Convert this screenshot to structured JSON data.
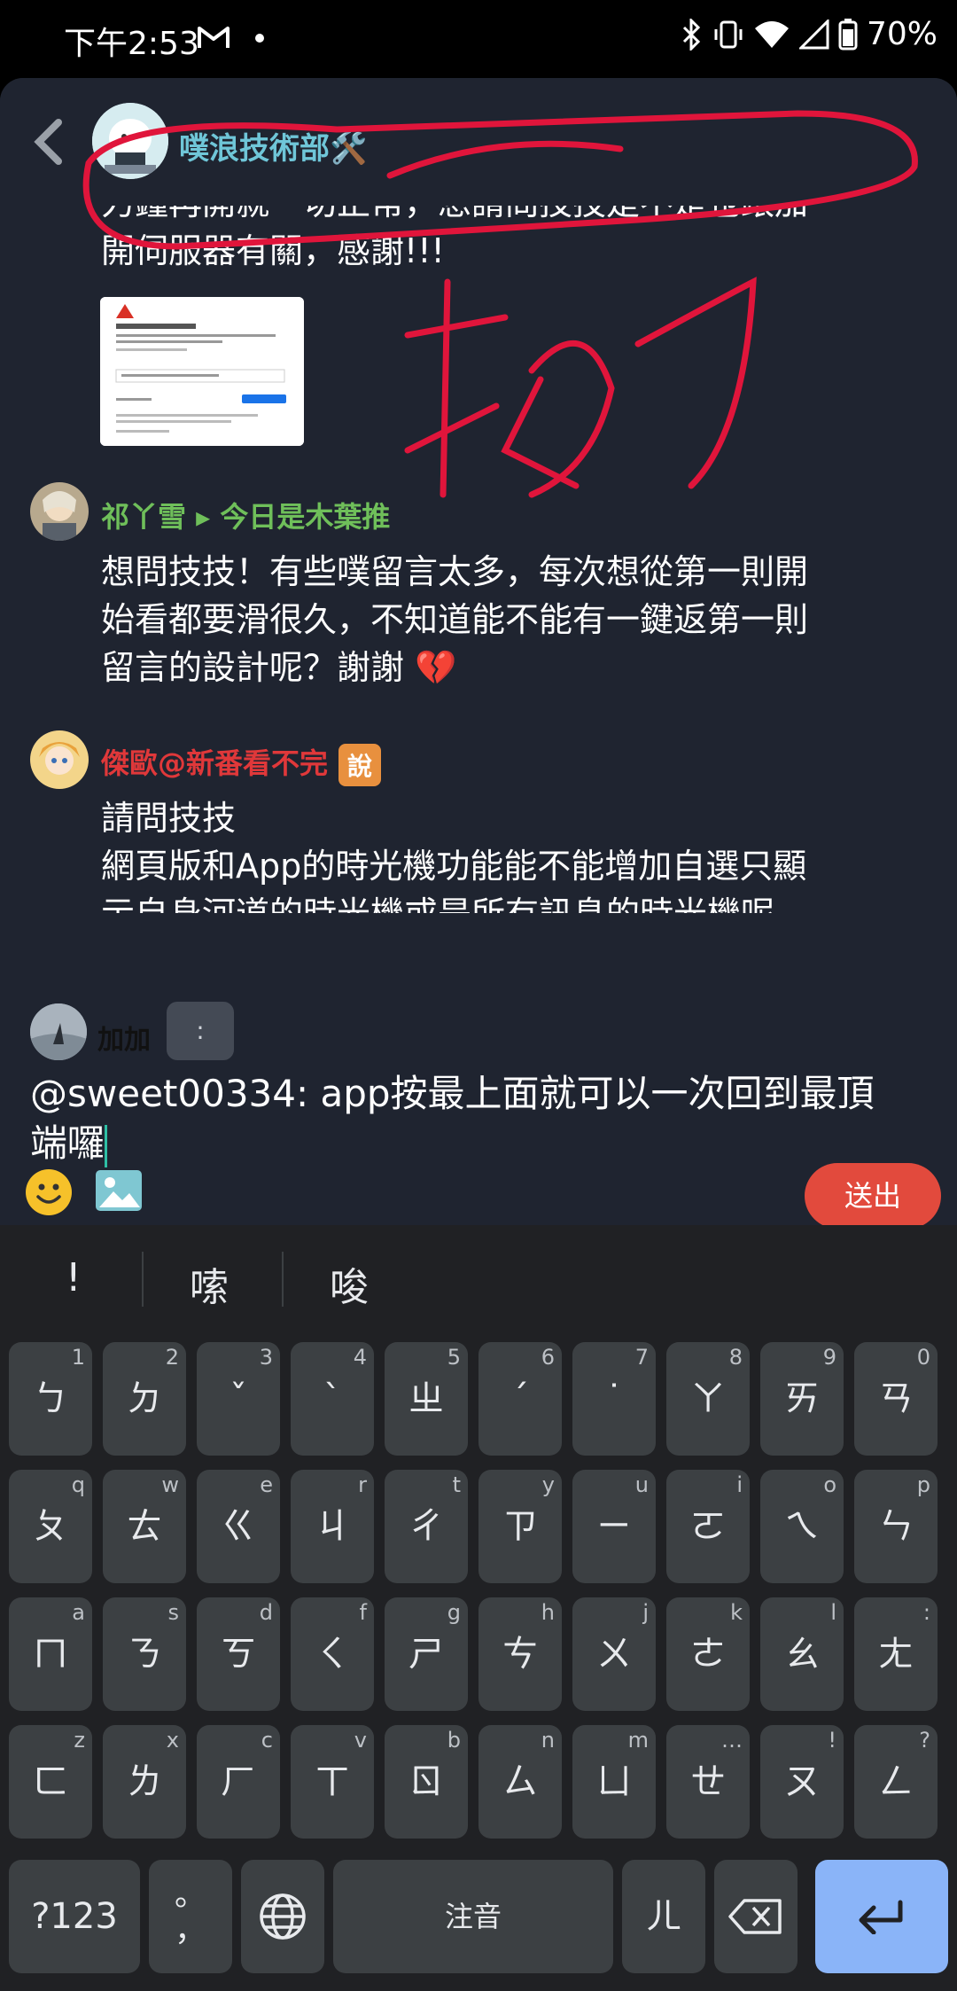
{
  "status_bar": {
    "time": "下午2:53",
    "battery": "70%"
  },
  "header": {
    "title": "噗浪技術部🛠️"
  },
  "messages": [
    {
      "text_lines": [
        "力鐘再開就一切正常，想請問技技是不是也跟加",
        "開伺服器有關，感謝!!!"
      ]
    }
  ],
  "comments": [
    {
      "name": "祁丫雪 ▸ 今日是木葉推",
      "name_color": "#6fbf5a",
      "lines": [
        "想問技技！有些噗留言太多，每次想從第一則開",
        "始看都要滑很久，不知道能不能有一鍵返第一則",
        "留言的設計呢？謝謝"
      ],
      "emoji": "💔"
    },
    {
      "name": "傑歐@新番看不完",
      "name_color": "#e0383a",
      "badge": "說",
      "lines": [
        "請問技技",
        "網頁版和App的時光機功能能不能增加自選只顯",
        "示自身河道的時光機或是所有訊息的時光機呢"
      ]
    }
  ],
  "reply": {
    "name": "加加",
    "colon_label": ":",
    "input_lines": [
      "@sweet00334: app按最上面就可以一次回到最頂",
      "端囉"
    ],
    "send_label": "送出"
  },
  "keyboard": {
    "suggestions": [
      "!",
      "嗦",
      "唆"
    ],
    "rows": [
      [
        [
          "ㄅ",
          "1"
        ],
        [
          "ㄉ",
          "2"
        ],
        [
          "ˇ",
          "3"
        ],
        [
          "ˋ",
          "4"
        ],
        [
          "ㄓ",
          "5"
        ],
        [
          "ˊ",
          "6"
        ],
        [
          "˙",
          "7"
        ],
        [
          "ㄚ",
          "8"
        ],
        [
          "ㄞ",
          "9"
        ],
        [
          "ㄢ",
          "0"
        ]
      ],
      [
        [
          "ㄆ",
          "q"
        ],
        [
          "ㄊ",
          "w"
        ],
        [
          "ㄍ",
          "e"
        ],
        [
          "ㄐ",
          "r"
        ],
        [
          "ㄔ",
          "t"
        ],
        [
          "ㄗ",
          "y"
        ],
        [
          "ㄧ",
          "u"
        ],
        [
          "ㄛ",
          "i"
        ],
        [
          "ㄟ",
          "o"
        ],
        [
          "ㄣ",
          "p"
        ]
      ],
      [
        [
          "ㄇ",
          "a"
        ],
        [
          "ㄋ",
          "s"
        ],
        [
          "ㄎ",
          "d"
        ],
        [
          "ㄑ",
          "f"
        ],
        [
          "ㄕ",
          "g"
        ],
        [
          "ㄘ",
          "h"
        ],
        [
          "ㄨ",
          "j"
        ],
        [
          "ㄜ",
          "k"
        ],
        [
          "ㄠ",
          "l"
        ],
        [
          "ㄤ",
          ":"
        ]
      ],
      [
        [
          "ㄈ",
          "z"
        ],
        [
          "ㄌ",
          "x"
        ],
        [
          "ㄏ",
          "c"
        ],
        [
          "ㄒ",
          "v"
        ],
        [
          "ㄖ",
          "b"
        ],
        [
          "ㄙ",
          "n"
        ],
        [
          "ㄩ",
          "m"
        ],
        [
          "ㄝ",
          "…"
        ],
        [
          "ㄡ",
          "!"
        ],
        [
          "ㄥ",
          "?"
        ]
      ]
    ],
    "symbols_label": "?123",
    "punct_label": "。\n，",
    "space_label": "注音",
    "er_label": "ㄦ"
  }
}
